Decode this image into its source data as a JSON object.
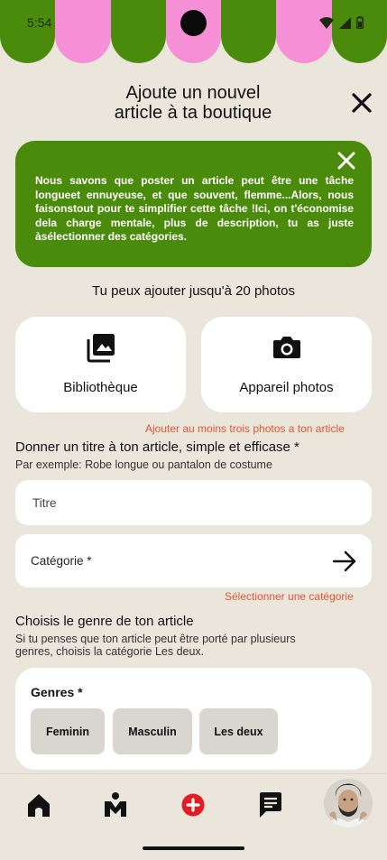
{
  "status_bar": {
    "time": "5:54"
  },
  "awning": {
    "colors": [
      "#4a8b0c",
      "#f58fd6"
    ]
  },
  "header": {
    "title_line1": "Ajoute un nouvel",
    "title_line2": "article à ta boutique",
    "close_icon": "close-icon"
  },
  "banner": {
    "text": "Nous savons que poster un article peut être une tâche longueet ennuyeuse, et que souvent, flemme...Alors, nous faisonstout pour te simplifier cette tâche !Ici, on t'économise dela charge mentale, plus de description, tu as juste àsélectionner des catégories.",
    "color": "#4a8b0c",
    "close_icon": "close-icon"
  },
  "photos": {
    "limit_text": "Tu peux ajouter jusqu'à 20 photos",
    "library_label": "Bibliothèque",
    "library_icon": "photo-library-icon",
    "camera_label": "Appareil photos",
    "camera_icon": "camera-icon",
    "warning": "Ajouter au moins trois photos a ton article"
  },
  "title_section": {
    "heading": "Donner un titre à ton article, simple et efficase *",
    "example": "Par exemple: Robe longue ou pantalon de costume",
    "placeholder": "Titre"
  },
  "category": {
    "label": "Catégorie *",
    "arrow_icon": "arrow-right-icon",
    "warning": "Sélectionner une catégorie"
  },
  "gender_section": {
    "heading": "Choisis le genre de ton article",
    "hint_line1": "Si tu penses que ton article peut être porté par plusieurs",
    "hint_line2": "genres, choisis la catégorie Les deux.",
    "label": "Genres *",
    "options": [
      "Feminin",
      "Masculin",
      "Les deux"
    ]
  },
  "accent_red": "#e5532f",
  "bottom_nav": {
    "items": [
      "home-icon",
      "brand-logo-icon",
      "add-icon",
      "messages-icon",
      "profile-avatar"
    ]
  }
}
